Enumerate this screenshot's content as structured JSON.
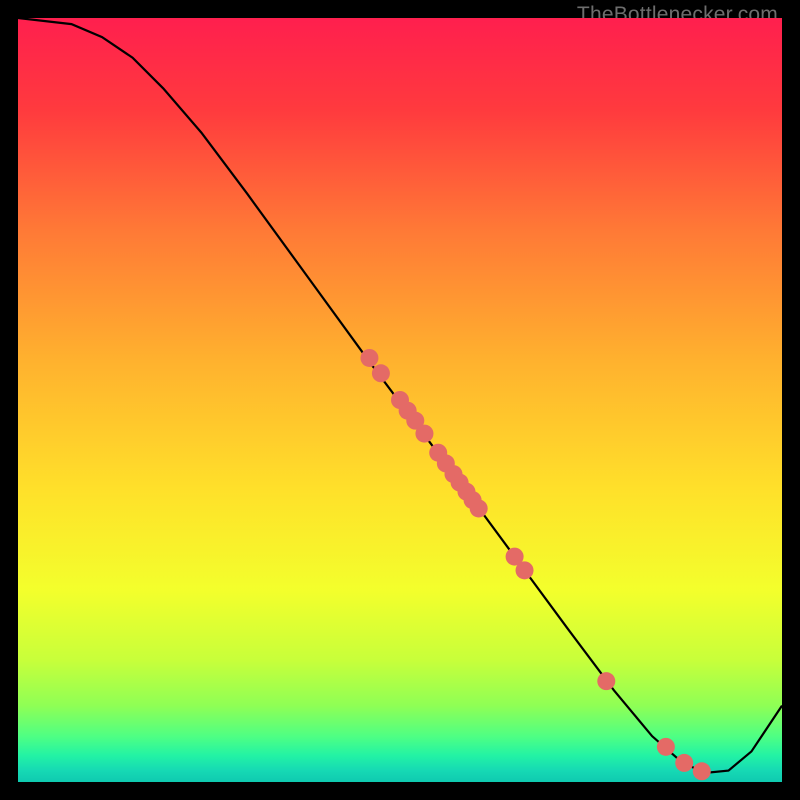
{
  "watermark": "TheBottlenecker.com",
  "chart_data": {
    "type": "line",
    "title": "",
    "xlabel": "",
    "ylabel": "",
    "xlim": [
      0,
      100
    ],
    "ylim": [
      0,
      100
    ],
    "grid": false,
    "background": "rainbow-vertical",
    "curve": [
      {
        "x": 0,
        "y": 100
      },
      {
        "x": 7,
        "y": 99.2
      },
      {
        "x": 11,
        "y": 97.5
      },
      {
        "x": 15,
        "y": 94.8
      },
      {
        "x": 19,
        "y": 90.8
      },
      {
        "x": 24,
        "y": 85
      },
      {
        "x": 30,
        "y": 77
      },
      {
        "x": 38,
        "y": 66
      },
      {
        "x": 46,
        "y": 55
      },
      {
        "x": 52,
        "y": 47
      },
      {
        "x": 58,
        "y": 39
      },
      {
        "x": 65,
        "y": 29.5
      },
      {
        "x": 72,
        "y": 20
      },
      {
        "x": 78,
        "y": 12
      },
      {
        "x": 83,
        "y": 6
      },
      {
        "x": 87,
        "y": 2.5
      },
      {
        "x": 90,
        "y": 1.2
      },
      {
        "x": 93,
        "y": 1.5
      },
      {
        "x": 96,
        "y": 4
      },
      {
        "x": 100,
        "y": 10
      }
    ],
    "markers": [
      {
        "x": 46,
        "y": 55.5
      },
      {
        "x": 47.5,
        "y": 53.5
      },
      {
        "x": 50,
        "y": 50
      },
      {
        "x": 51,
        "y": 48.6
      },
      {
        "x": 52,
        "y": 47.3
      },
      {
        "x": 53.2,
        "y": 45.6
      },
      {
        "x": 55,
        "y": 43.1
      },
      {
        "x": 56,
        "y": 41.7
      },
      {
        "x": 57,
        "y": 40.3
      },
      {
        "x": 57.8,
        "y": 39.2
      },
      {
        "x": 58.7,
        "y": 38
      },
      {
        "x": 59.5,
        "y": 36.9
      },
      {
        "x": 60.3,
        "y": 35.8
      },
      {
        "x": 65,
        "y": 29.5
      },
      {
        "x": 66.3,
        "y": 27.7
      },
      {
        "x": 77,
        "y": 13.2
      },
      {
        "x": 84.8,
        "y": 4.6
      },
      {
        "x": 87.2,
        "y": 2.5
      },
      {
        "x": 89.5,
        "y": 1.4
      }
    ],
    "gradient_stops": [
      {
        "offset": 0,
        "color": "#ff1f4e"
      },
      {
        "offset": 0.12,
        "color": "#ff3a3e"
      },
      {
        "offset": 0.28,
        "color": "#ff7a36"
      },
      {
        "offset": 0.45,
        "color": "#ffb22e"
      },
      {
        "offset": 0.62,
        "color": "#ffe12a"
      },
      {
        "offset": 0.75,
        "color": "#f3ff2c"
      },
      {
        "offset": 0.84,
        "color": "#c8ff3a"
      },
      {
        "offset": 0.9,
        "color": "#8fff55"
      },
      {
        "offset": 0.94,
        "color": "#4fff83"
      },
      {
        "offset": 0.965,
        "color": "#23f3a4"
      },
      {
        "offset": 0.985,
        "color": "#16d9b4"
      },
      {
        "offset": 1.0,
        "color": "#0fcab0"
      }
    ],
    "marker_color": "#e46a66",
    "line_color": "#000000"
  }
}
